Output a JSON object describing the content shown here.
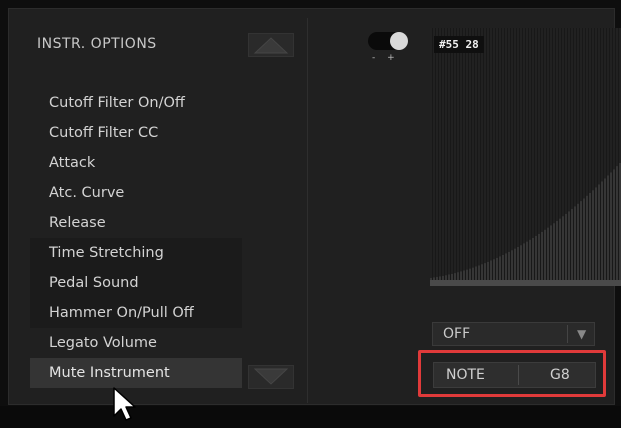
{
  "options_panel": {
    "title": "INSTR. OPTIONS",
    "items": [
      "Cutoff Filter On/Off",
      "Cutoff Filter CC",
      "Attack",
      "Atc. Curve",
      "Release",
      "Time Stretching",
      "Pedal Sound",
      "Hammer On/Pull Off",
      "Legato Volume",
      "Mute Instrument"
    ],
    "selected_item": "Mute Instrument"
  },
  "toggle": {
    "minus_label": "-",
    "plus_label": "+",
    "state": "on"
  },
  "display": {
    "readout": "#55 28"
  },
  "dropdown": {
    "value": "OFF",
    "arrow_icon": "triangle-down-icon"
  },
  "note_field": {
    "label": "NOTE",
    "value": "G8"
  },
  "colors": {
    "highlight": "#e03a3a",
    "panel_bg": "#202020"
  }
}
